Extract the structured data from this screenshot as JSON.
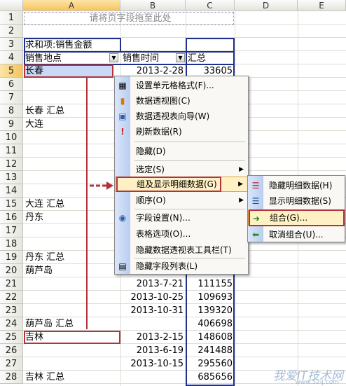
{
  "columns": [
    "A",
    "B",
    "C",
    "D",
    "E"
  ],
  "rows": [
    "1",
    "2",
    "3",
    "4",
    "5",
    "6",
    "7",
    "8",
    "9",
    "10",
    "11",
    "12",
    "13",
    "14",
    "15",
    "16",
    "17",
    "18",
    "19",
    "20",
    "21",
    "22",
    "23",
    "24",
    "25",
    "26",
    "27",
    "28"
  ],
  "pivot": {
    "drop_placeholder": "请将页字段拖至此处",
    "data_label": "求和项:销售金额",
    "header_location": "销售地点",
    "header_time": "销售时间",
    "header_total": "汇总"
  },
  "cells": {
    "a5": "长春",
    "b5": "2013-2-28",
    "c5": "33605",
    "a8": "长春 汇总",
    "a9": "大连",
    "a15": "大连 汇总",
    "a16": "丹东",
    "a19": "丹东 汇总",
    "a20": "葫芦岛",
    "b21": "2013-7-21",
    "c21": "111155",
    "b22": "2013-10-25",
    "c22": "109693",
    "b23": "2013-10-31",
    "c23": "139320",
    "a24": "葫芦岛 汇总",
    "c24": "406698",
    "a25": "吉林",
    "b25": "2013-2-15",
    "c25": "148608",
    "b26": "2013-6-19",
    "c26": "241488",
    "b27": "2013-10-15",
    "c27": "295560",
    "a28": "吉林 汇总",
    "c28": "685656"
  },
  "context_menu": {
    "items": [
      {
        "label": "设置单元格格式(F)...",
        "icon": "format-cells-icon"
      },
      {
        "label": "数据透视图(C)",
        "icon": "pivot-chart-icon"
      },
      {
        "label": "数据透视表向导(W)",
        "icon": "wizard-icon"
      },
      {
        "label": "刷新数据(R)",
        "icon": "refresh-icon"
      },
      {
        "label": "隐藏(D)",
        "icon": ""
      },
      {
        "label": "选定(S)",
        "icon": ""
      },
      {
        "label": "组及显示明细数据(G)",
        "icon": ""
      },
      {
        "label": "顺序(O)",
        "icon": ""
      },
      {
        "label": "字段设置(N)...",
        "icon": "field-settings-icon"
      },
      {
        "label": "表格选项(O)...",
        "icon": ""
      },
      {
        "label": "隐藏数据透视表工具栏(T)",
        "icon": ""
      },
      {
        "label": "隐藏字段列表(L)",
        "icon": "field-list-icon"
      }
    ]
  },
  "submenu": {
    "items": [
      {
        "label": "隐藏明细数据(H)",
        "icon": "hide-detail-icon"
      },
      {
        "label": "显示明细数据(S)",
        "icon": "show-detail-icon"
      },
      {
        "label": "组合(G)...",
        "icon": "group-icon"
      },
      {
        "label": "取消组合(U)...",
        "icon": "ungroup-icon"
      }
    ]
  },
  "watermark": "我爱IT技术网",
  "watermark_url": "www.52ij.com"
}
